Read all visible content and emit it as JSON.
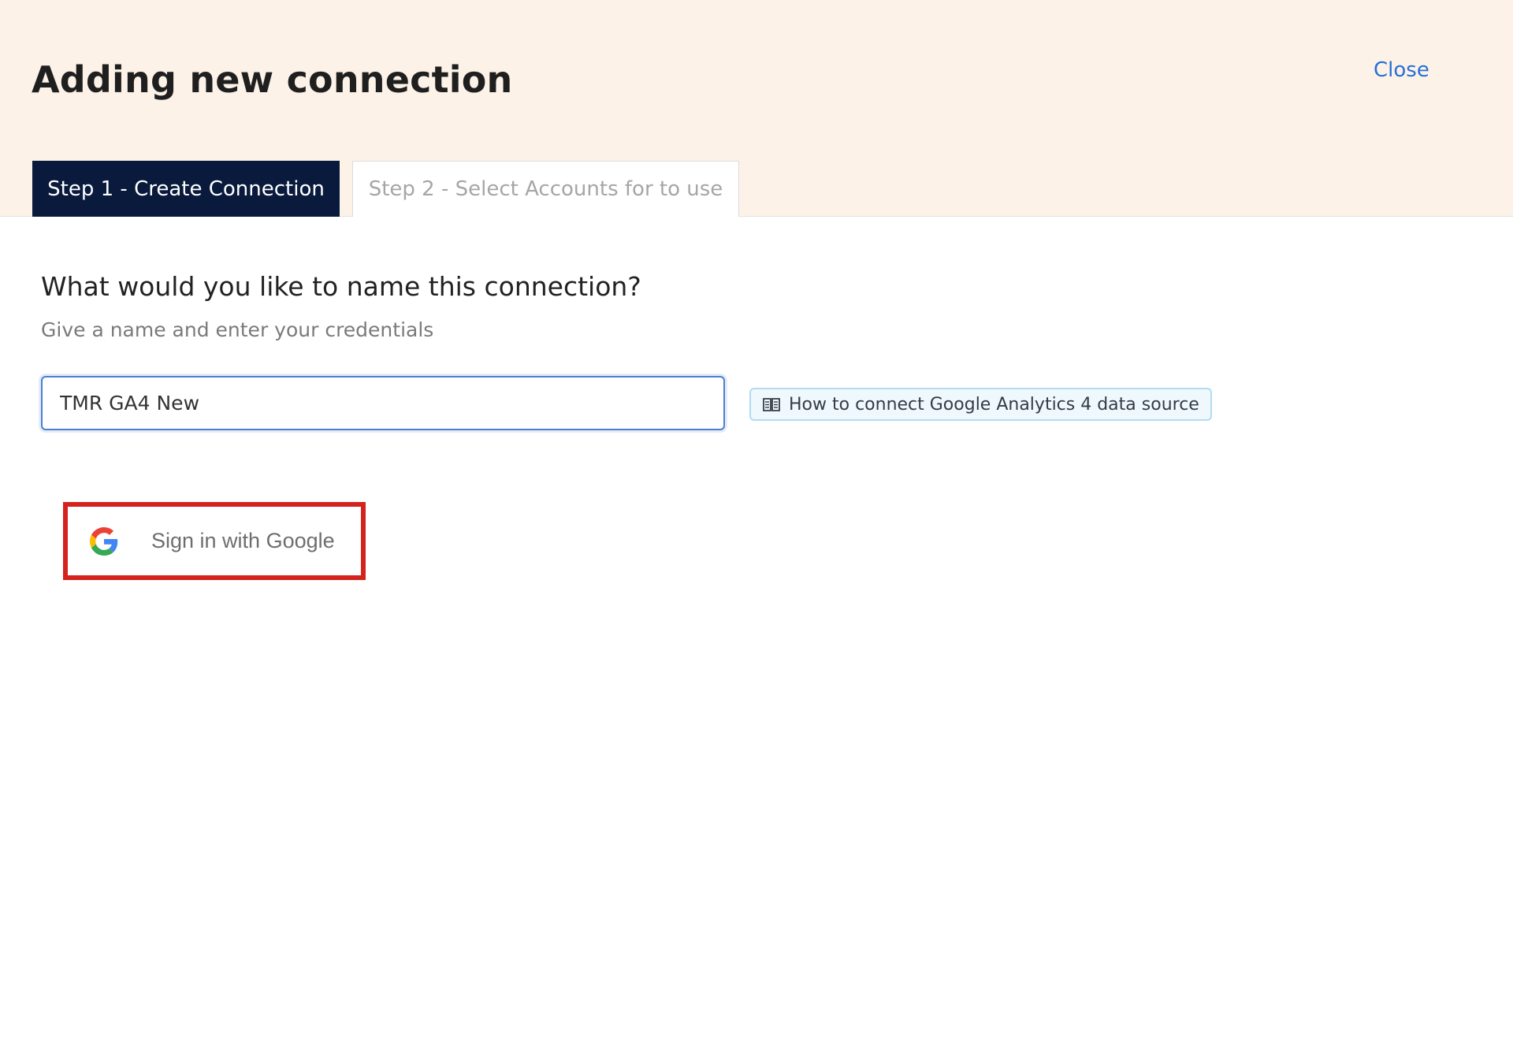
{
  "header": {
    "title": "Adding new connection",
    "close_label": "Close",
    "tabs": [
      {
        "label": "Step 1 - Create Connection",
        "active": true
      },
      {
        "label": "Step 2 - Select Accounts for to use",
        "active": false
      }
    ]
  },
  "form": {
    "question": "What would you like to name this connection?",
    "subtitle": "Give a name and enter your credentials",
    "connection_name_value": "TMR GA4 New",
    "help_link_label": "How to connect Google Analytics 4 data source",
    "help_link_icon": "book-icon"
  },
  "google_signin": {
    "label": "Sign in with Google",
    "icon": "google-icon",
    "highlight_color": "#d4231d"
  },
  "colors": {
    "header_bg": "#fcf2e8",
    "active_tab_bg": "#091a3d",
    "link": "#2870d4",
    "input_border": "#4a7fd0"
  }
}
